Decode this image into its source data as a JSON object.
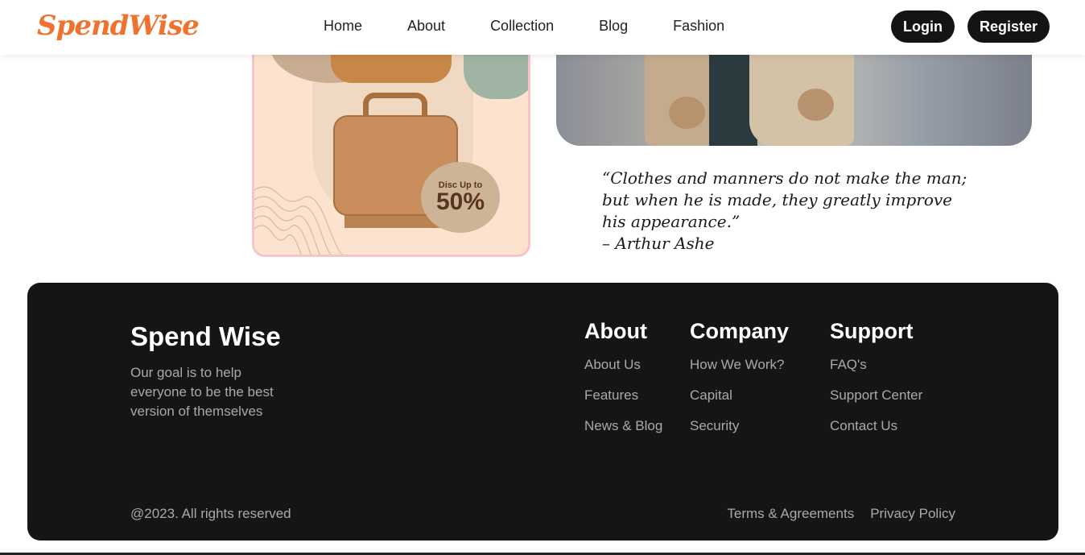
{
  "navbar": {
    "logo": "SpendWise",
    "links": [
      "Home",
      "About",
      "Collection",
      "Blog",
      "Fashion"
    ],
    "login_label": "Login",
    "register_label": "Register"
  },
  "promo": {
    "disc_label": "Disc Up to",
    "disc_value": "50%"
  },
  "quote": {
    "line1": "“Clothes and manners do not make the man;",
    "line2": "but when he is made, they greatly improve",
    "line3": "his appearance.”",
    "author": "– Arthur Ashe"
  },
  "footer": {
    "brand": "Spend Wise",
    "tagline": "Our goal is to help everyone to be the best version of themselves",
    "columns": [
      {
        "title": "About",
        "links": [
          "About Us",
          "Features",
          "News & Blog"
        ]
      },
      {
        "title": "Company",
        "links": [
          "How We Work?",
          "Capital",
          "Security"
        ]
      },
      {
        "title": "Support",
        "links": [
          "FAQ's",
          "Support Center",
          "Contact Us"
        ]
      }
    ],
    "copyright": "@2023. All rights reserved",
    "terms_label": "Terms & Agreements",
    "privacy_label": "Privacy Policy"
  },
  "colors": {
    "brand_orange": "#f0722e",
    "footer_bg": "#151515",
    "button_bg": "#141414"
  }
}
